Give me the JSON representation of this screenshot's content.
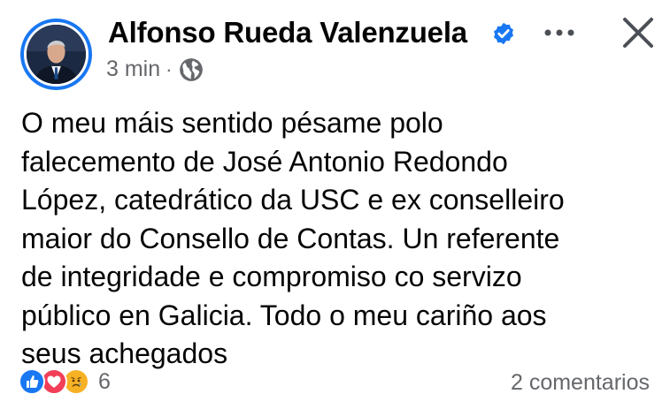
{
  "author": {
    "name": "Alfonso Rueda Valenzuela",
    "verified": true,
    "avatar": "avatar"
  },
  "meta": {
    "time": "3 min",
    "separator": "·",
    "audience_icon": "globe-icon"
  },
  "header_actions": {
    "more_icon": "more-options-icon",
    "close_icon": "close-icon"
  },
  "post": {
    "text": "O meu máis sentido pésame polo\nfalecemento de José Antonio Redondo\nLópez, catedrático da USC e ex conselleiro\nmaior do Consello de Contas. Un referente\nde integridade e compromiso co servizo\npúblico en Galicia. Todo o meu cariño aos\nseus achegados"
  },
  "footer": {
    "reactions": [
      "like-icon",
      "love-icon",
      "sad-icon"
    ],
    "reaction_count": "6",
    "comments": "2 comentarios"
  },
  "colors": {
    "accent": "#1877f2",
    "secondary_text": "#65676b",
    "love": "#f33e58",
    "sad": "#f7b125"
  }
}
